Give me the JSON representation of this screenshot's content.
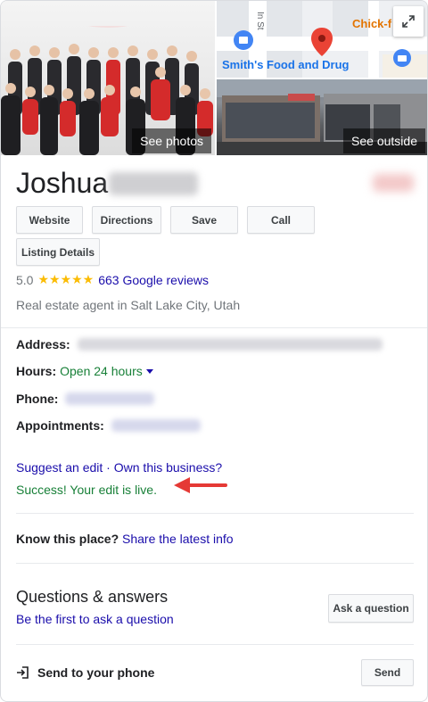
{
  "hero": {
    "see_photos": "See photos",
    "see_outside": "See outside",
    "map_labels": {
      "store": "Smith's Food and Drug",
      "chick": "Chick-f",
      "street": "In St"
    }
  },
  "business": {
    "name": "Joshua",
    "category": "Real estate agent in Salt Lake City, Utah",
    "rating": "5.0",
    "stars": "★★★★★",
    "reviews": "663 Google reviews"
  },
  "actions": {
    "website": "Website",
    "directions": "Directions",
    "save": "Save",
    "call": "Call",
    "listing_details": "Listing Details"
  },
  "info": {
    "address_label": "Address:",
    "hours_label": "Hours:",
    "hours_value": "Open 24 hours",
    "phone_label": "Phone:",
    "appointments_label": "Appointments:"
  },
  "edit": {
    "suggest": "Suggest an edit",
    "separator": " · ",
    "own": "Own this business?",
    "success": "Success! Your edit is live."
  },
  "know": {
    "label": "Know this place?",
    "link": "Share the latest info"
  },
  "qa": {
    "title": "Questions & answers",
    "sub": "Be the first to ask a question",
    "ask_button": "Ask a question"
  },
  "send": {
    "label": "Send to your phone",
    "button": "Send"
  },
  "colors": {
    "link": "#1a0dab",
    "green": "#188038",
    "star": "#fbbc04",
    "arrow": "#e53935",
    "map_pin_red": "#ea4335",
    "map_pin_blue": "#4285f4",
    "chick_orange": "#e37400"
  }
}
